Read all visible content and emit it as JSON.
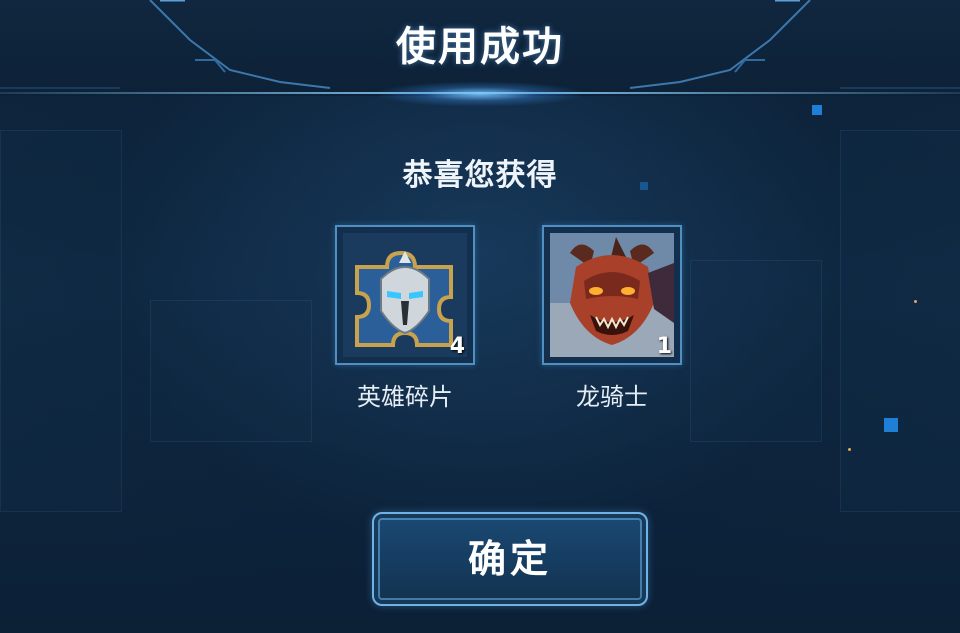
{
  "dialog": {
    "title": "使用成功",
    "subtitle": "恭喜您获得",
    "confirm_label": "确定"
  },
  "rewards": [
    {
      "name": "英雄碎片",
      "count": "4",
      "icon": "helmet-shard-icon"
    },
    {
      "name": "龙骑士",
      "count": "1",
      "icon": "dragon-knight-portrait"
    }
  ],
  "colors": {
    "accent": "#4f8fc2",
    "background": "#0f2a44",
    "text": "#ffffff"
  }
}
